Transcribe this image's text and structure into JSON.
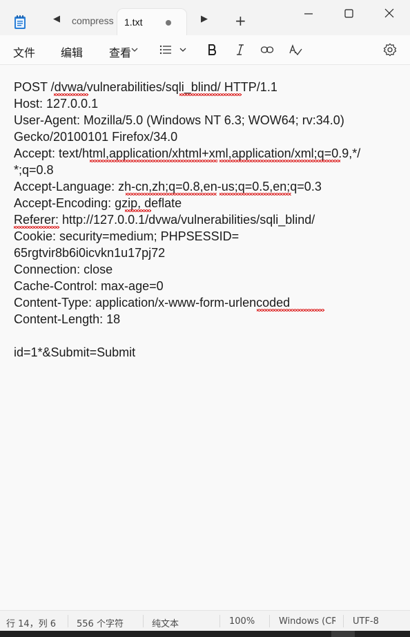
{
  "tabs": {
    "inactive_label": "compress",
    "active_label": "1.txt",
    "prev_glyph": "◀",
    "next_glyph": "▶",
    "new_tab_glyph": "+"
  },
  "window_controls": [
    "minimize-icon",
    "maximize-icon",
    "close-icon"
  ],
  "menu": {
    "file": "文件",
    "edit": "编辑",
    "view": "查看"
  },
  "toolbar_icons": [
    "list-icon",
    "chevron-down-icon",
    "bold-icon",
    "italic-icon",
    "link-icon",
    "spellcheck-icon",
    "settings-icon"
  ],
  "editor": {
    "lines": [
      "POST /dvwa/vulnerabilities/sqli_blind/ HTTP/1.1",
      "Host: 127.0.0.1",
      "User-Agent: Mozilla/5.0 (Windows NT 6.3; WOW64; rv:34.0)",
      "Gecko/20100101 Firefox/34.0",
      "Accept: text/html,application/xhtml+xml,application/xml;q=0.9,*/",
      "*;q=0.8",
      "Accept-Language: zh-cn,zh;q=0.8,en-us;q=0.5,en;q=0.3",
      "Accept-Encoding: gzip, deflate",
      "Referer: http://127.0.0.1/dvwa/vulnerabilities/sqli_blind/",
      "Cookie: security=medium; PHPSESSID=",
      "65rgtvir8b6i0icvkn1u17pj72",
      "Connection: close",
      "Cache-Control: max-age=0",
      "Content-Type: application/x-www-form-urlencoded",
      "Content-Length: 18",
      "",
      "id=1*&Submit=Submit"
    ]
  },
  "status": {
    "position": "行 14，列 6",
    "char_count": "556 个字符",
    "format": "纯文本",
    "zoom": "100%",
    "line_ending": "Windows (CRLF)",
    "encoding": "UTF-8"
  }
}
